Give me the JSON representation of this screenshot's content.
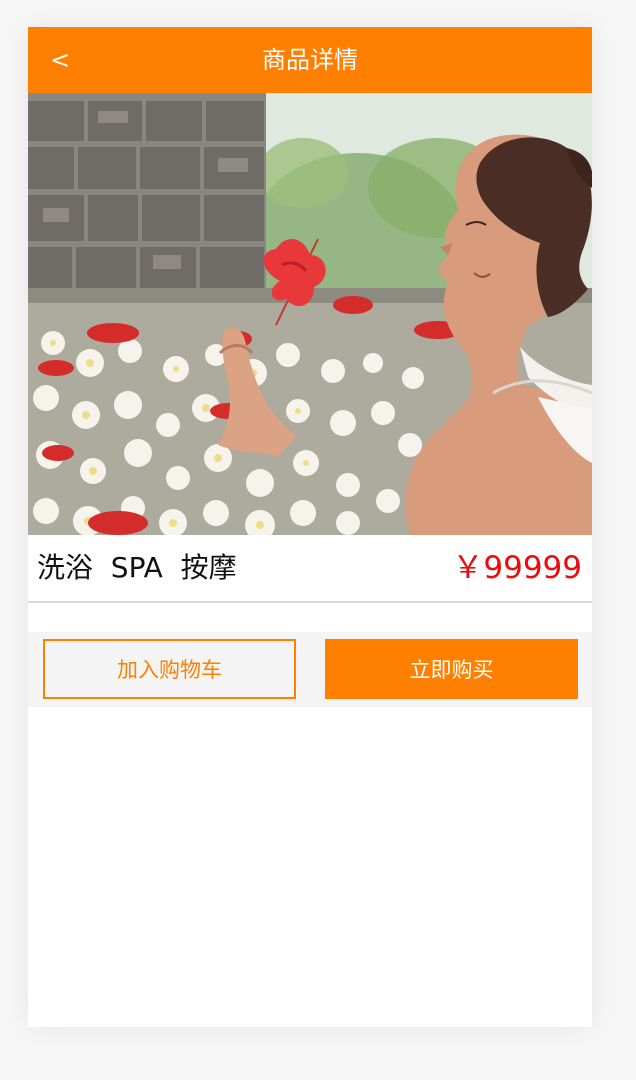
{
  "header": {
    "back_label": "<",
    "title": "商品详情"
  },
  "product": {
    "image_icon": "spa-photo",
    "name": "洗浴  SPA  按摩",
    "price": "￥99999"
  },
  "actions": {
    "add_to_cart": "加入购物车",
    "buy_now": "立即购买"
  },
  "colors": {
    "accent": "#ff7f00",
    "price": "#ee0b0b",
    "page_bg": "#f7f7f7"
  }
}
